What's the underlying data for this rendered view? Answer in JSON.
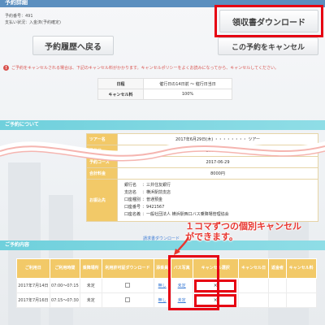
{
  "header": {
    "title": "予約詳細"
  },
  "meta": {
    "reservation_no": "予約番号：491",
    "payment_status": "支払い状況：入金済(予約確定)"
  },
  "buttons": {
    "receipt": "領収書ダウンロード",
    "back": "予約履歴へ戻る",
    "cancel": "この予約をキャンセル"
  },
  "notice": {
    "icon": "!",
    "text": "ご予約をキャンセルされる場合は、下記のキャンセル料がかかります。キャンセルポリシーをよくお読みになってから、キャンセルしてください。"
  },
  "policy": {
    "rows": [
      {
        "k": "日程",
        "v": "催行日の14日前 〜 催行日当日"
      },
      {
        "k": "キャンセル料",
        "v": "100%"
      }
    ]
  },
  "sections": {
    "about": "ご予約について",
    "contents": "ご予約内容"
  },
  "detail": {
    "tour_label": "ツアー名",
    "tour_value": "2017年6月29日(木) ・・・・・・・・ ツアー",
    "date_label": "予約日",
    "date_value": "2017-03-06",
    "deadline_label": "予約コース",
    "deadline_value": "2017-06-29",
    "fee_label": "合計料金",
    "fee_value": "8000円",
    "bank_label": "お振込先",
    "bank": [
      {
        "k": "銀行名",
        "v": "三井住友銀行"
      },
      {
        "k": "支店名",
        "v": "横浜駅前支店"
      },
      {
        "k": "口座種別",
        "v": "普通預金"
      },
      {
        "k": "口座番号",
        "v": "9421567"
      },
      {
        "k": "口座名義",
        "v": "一般社団法人 横浜駅西口バス乗降場管理協会"
      }
    ]
  },
  "invoice_link": "請求書ダウンロード",
  "callout": {
    "line1": "１コマずつの個別キャンセル",
    "line2": "ができます。"
  },
  "table": {
    "headers": [
      "ご利用日",
      "ご利用時間",
      "乗降場所",
      "利用許可証ダウンロード",
      "添乗員",
      "バス写真",
      "キャンセル選択",
      "キャンセル日",
      "返金者",
      "キャンセル料"
    ],
    "rows": [
      {
        "date": "2017年7月14日",
        "time": "07:00〜07:15",
        "place": "未定",
        "link1": "無し",
        "link2": "未定",
        "cancel": "×"
      },
      {
        "date": "2017年7月16日",
        "time": "07:15〜07:30",
        "place": "未定",
        "link1": "無し",
        "link2": "未定",
        "cancel": "×"
      }
    ]
  },
  "colors": {
    "accent": "#e60012",
    "section": "#6fd0dc",
    "gold": "#f2c968",
    "topbar": "#5b8fbf"
  }
}
